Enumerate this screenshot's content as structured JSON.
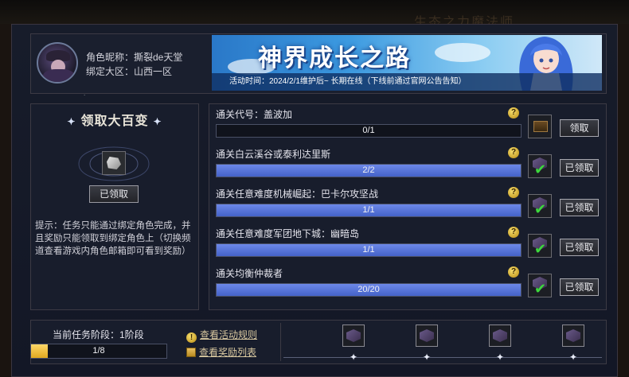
{
  "background_title": "生态之力魔法师",
  "profile": {
    "nickname": "角色昵称：撕裂de天堂",
    "region": "绑定大区：山西一区"
  },
  "banner": {
    "title": "神界成长之路",
    "subtitle": "活动时间：2024/2/1维护后~ 长期在线（下线前通过官网公告告知）"
  },
  "grand_reward": {
    "title": "领取大百变",
    "button": "已领取",
    "tip": "提示：任务只能通过绑定角色完成，并且奖励只能领取到绑定角色上（切换频道查看游戏内角色邮箱即可看到奖励）"
  },
  "tasks": [
    {
      "name": "通关代号：盖波加",
      "progress": "0/1",
      "fill": 0,
      "button": "领取",
      "claimed": false
    },
    {
      "name": "通关白云溪谷或泰利达里斯",
      "progress": "2/2",
      "fill": 1,
      "button": "已领取",
      "claimed": true
    },
    {
      "name": "通关任意难度机械崛起：巴卡尔攻坚战",
      "progress": "1/1",
      "fill": 1,
      "button": "已领取",
      "claimed": true
    },
    {
      "name": "通关任意难度军团地下城：幽暗岛",
      "progress": "1/1",
      "fill": 1,
      "button": "已领取",
      "claimed": true
    },
    {
      "name": "通关均衡仲裁者",
      "progress": "20/20",
      "fill": 1,
      "button": "已领取",
      "claimed": true
    }
  ],
  "stage": {
    "label": "当前任务阶段：1阶段",
    "progress": "1/8",
    "fill": 0.125,
    "rules_link": "查看活动规则",
    "rewards_link": "查看奖励列表"
  },
  "colors": {
    "accent_blue": "#5474d8",
    "stage_gold": "#f0c040",
    "check_green": "#3cd83c"
  }
}
